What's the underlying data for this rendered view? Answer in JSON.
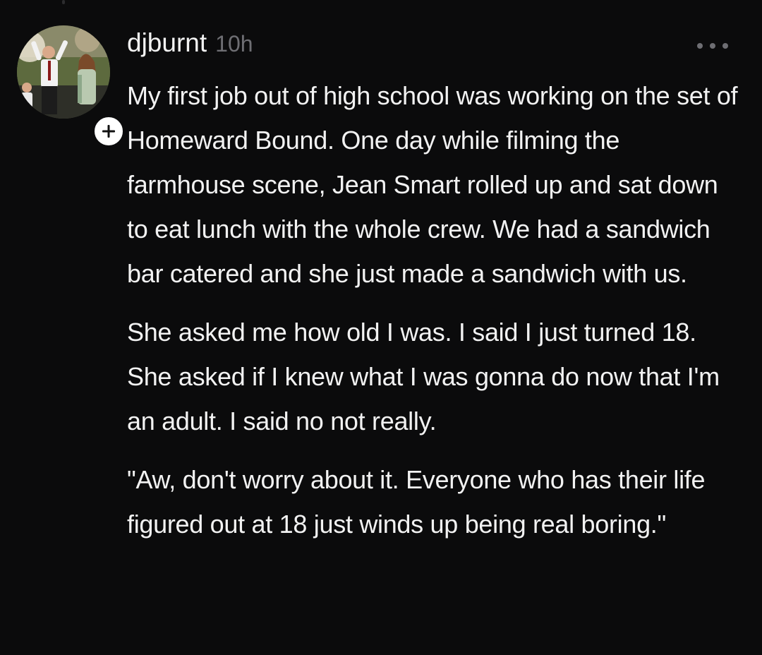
{
  "comment": {
    "username": "djburnt",
    "timestamp": "10h",
    "paragraphs": [
      "My first job out of high school was working on the set of Homeward Bound. One day while filming the farmhouse scene, Jean Smart rolled up and sat down to eat lunch with the whole crew. We had a sandwich bar catered and she just made a sandwich with us.",
      "She asked me how old I was. I said I just turned 18. She asked if I knew what I was gonna do now that I'm an adult. I said no not really.",
      "\"Aw, don't worry about it. Everyone who has their life figured out at 18 just winds up being real boring.\""
    ]
  },
  "icons": {
    "follow": "plus-icon",
    "more": "more-horizontal-icon"
  },
  "colors": {
    "background": "#0b0b0c",
    "text": "#f2f2f2",
    "muted": "#6e6e73",
    "badge": "#ffffff"
  }
}
